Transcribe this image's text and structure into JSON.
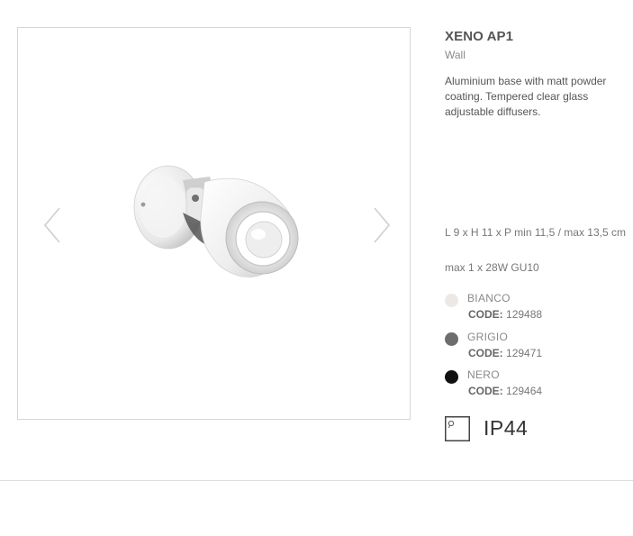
{
  "product": {
    "title": "XENO AP1",
    "category": "Wall",
    "description": "Aluminium base with matt powder coating. Tempered clear glass adjustable diffusers.",
    "dimensions": "L 9 x H 11 x P min 11,5 / max 13,5 cm",
    "lamp": "max 1 x 28W GU10"
  },
  "gallery": {
    "prev_icon": "chevron-left-icon",
    "next_icon": "chevron-right-icon",
    "image": "wall-spotlight-photo"
  },
  "variants": [
    {
      "name": "BIANCO",
      "code_label": "CODE:",
      "code": "129488",
      "color": "#ece9e4"
    },
    {
      "name": "GRIGIO",
      "code_label": "CODE:",
      "code": "129471",
      "color": "#6d6d6d"
    },
    {
      "name": "NERO",
      "code_label": "CODE:",
      "code": "129464",
      "color": "#111111"
    }
  ],
  "ip_rating": {
    "icon": "ip-rating-icon",
    "label": "IP44"
  }
}
